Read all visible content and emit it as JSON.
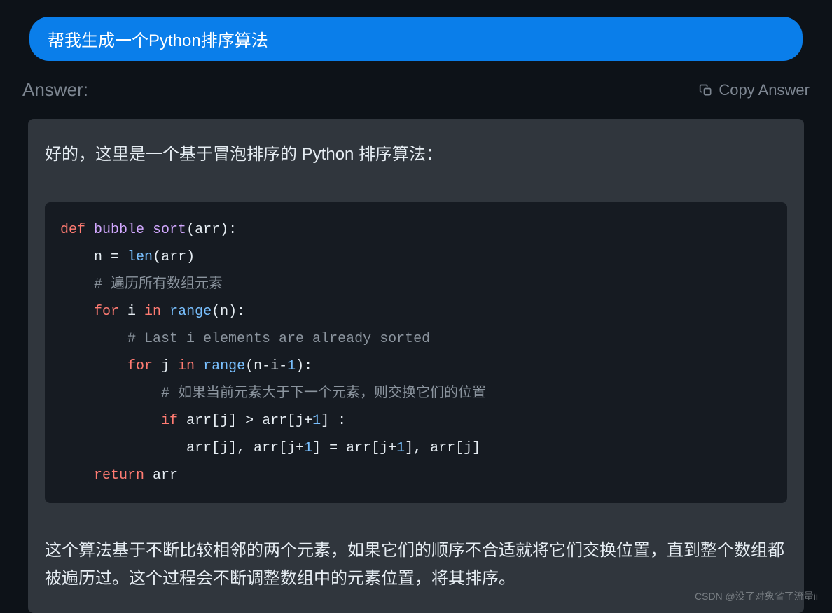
{
  "prompt": "帮我生成一个Python排序算法",
  "answer_label": "Answer:",
  "copy_label": "Copy Answer",
  "intro": "好的，这里是一个基于冒泡排序的 Python 排序算法：",
  "code": {
    "l1": {
      "def": "def",
      "fn": "bubble_sort",
      "open": "(arr):"
    },
    "l2": {
      "indent": "    ",
      "n": "n ",
      "eq": "= ",
      "len": "len",
      "rest": "(arr)"
    },
    "l3": {
      "indent": "    ",
      "comment": "# 遍历所有数组元素"
    },
    "l4": {
      "indent": "    ",
      "for": "for",
      "var": " i ",
      "in": "in",
      "sp": " ",
      "range": "range",
      "rest": "(n):"
    },
    "l5": {
      "indent": "        ",
      "comment": "# Last i elements are already sorted"
    },
    "l6": {
      "indent": "        ",
      "for": "for",
      "var": " j ",
      "in": "in",
      "sp": " ",
      "range": "range",
      "open": "(n-i-",
      "one": "1",
      "close": "):"
    },
    "l7": {
      "indent": "            ",
      "comment": "# 如果当前元素大于下一个元素，则交换它们的位置"
    },
    "l8": {
      "indent": "            ",
      "if": "if",
      "a": " arr[j] > arr[j+",
      "b": "1",
      "c": "] :"
    },
    "l9": {
      "indent": "               ",
      "a": "arr[j], arr[j+",
      "b": "1",
      "c": "] = arr[j+",
      "d": "1",
      "e": "], arr[j]"
    },
    "l10": {
      "indent": "    ",
      "return": "return",
      "rest": " arr"
    }
  },
  "outro": "这个算法基于不断比较相邻的两个元素，如果它们的顺序不合适就将它们交换位置，直到整个数组都被遍历过。这个过程会不断调整数组中的元素位置，将其排序。",
  "watermark": "CSDN @没了对象省了流量ii"
}
